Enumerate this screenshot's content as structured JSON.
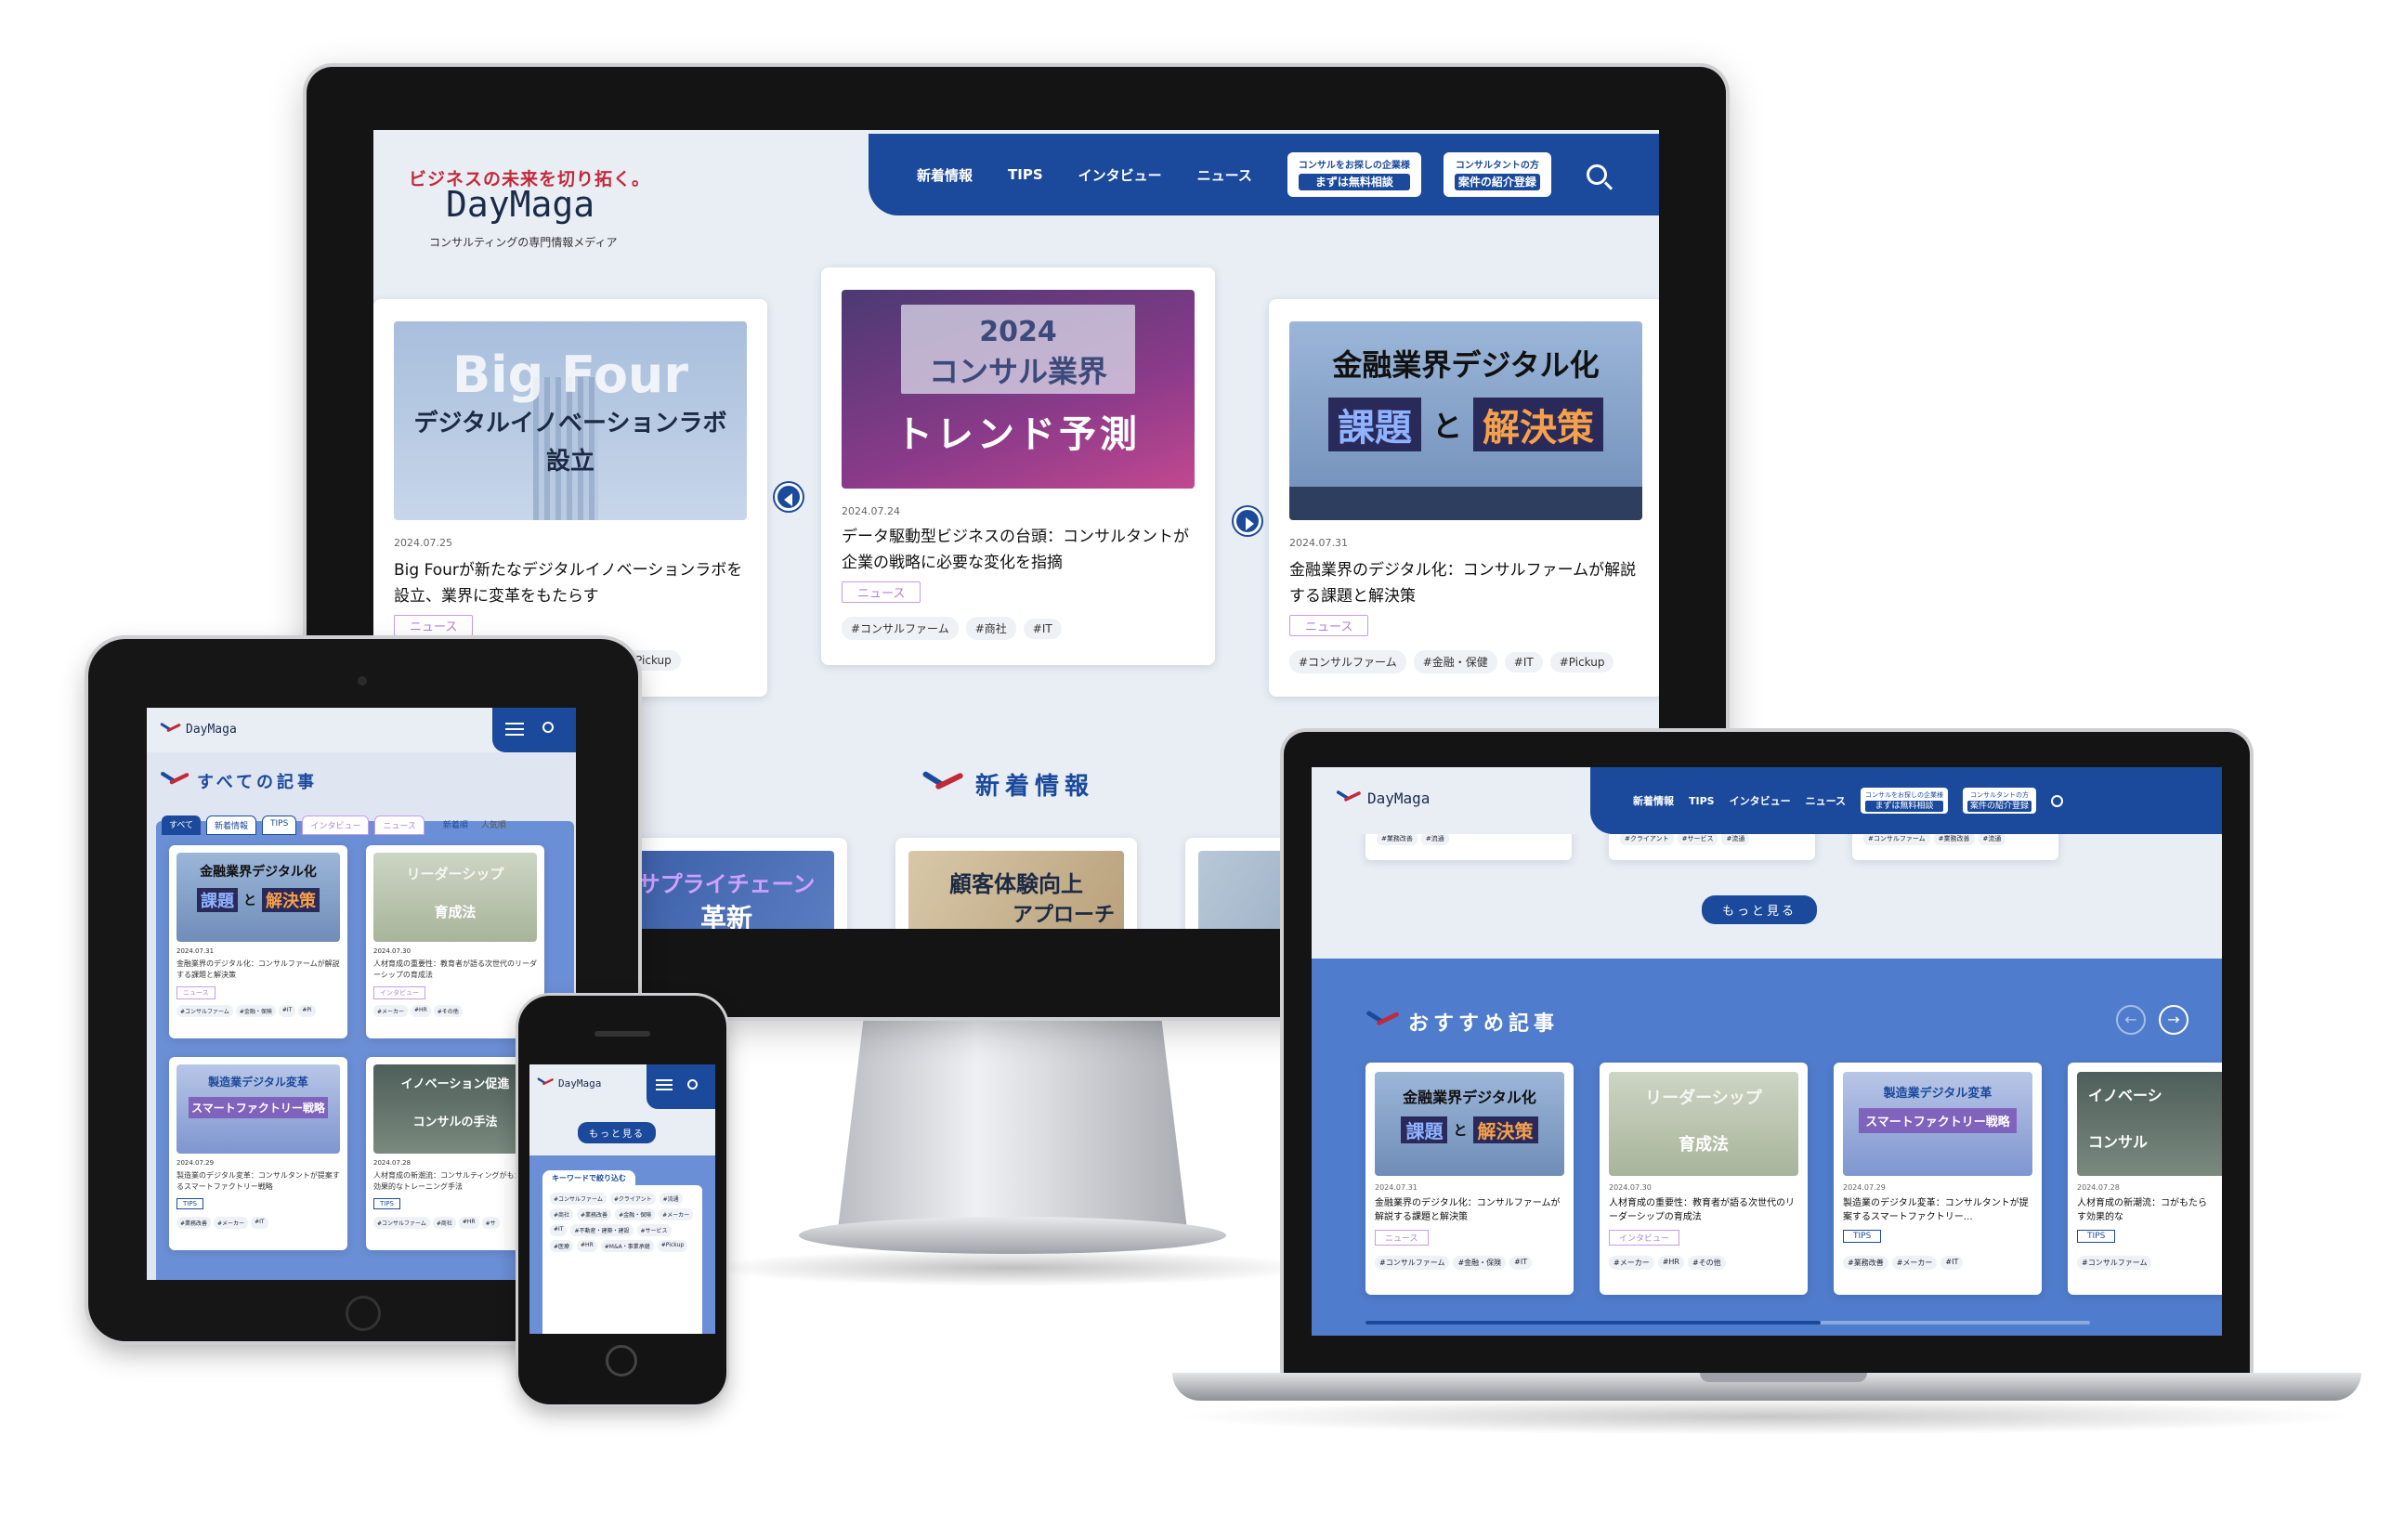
{
  "site": {
    "catchphrase": "ビジネスの未来を切り拓く。",
    "logo": "DayMaga",
    "subtitle": "コンサルティングの専門情報メディア"
  },
  "nav": {
    "items": [
      "新着情報",
      "TIPS",
      "インタビュー",
      "ニュース"
    ],
    "cta_company_small": "コンサルをお探しの企業様",
    "cta_company_big": "まずは無料相談",
    "cta_consultant_small": "コンサルタントの方",
    "cta_consultant_big": "案件の紹介登録",
    "search_icon": "search-icon"
  },
  "featured": [
    {
      "thumb_title": "Big Four",
      "thumb_line1": "デジタルイノベーションラボ",
      "thumb_line2": "設立",
      "date": "2024.07.25",
      "title": "Big Fourが新たなデジタルイノベーションラボを設立、業界に変革をもたらす",
      "category": "ニュース",
      "tags": [
        "#Pickup"
      ]
    },
    {
      "thumb_line1": "2024",
      "thumb_line2": "コンサル業界",
      "thumb_line3": "トレンド予測",
      "date": "2024.07.24",
      "title": "データ駆動型ビジネスの台頭：コンサルタントが企業の戦略に必要な変化を指摘",
      "category": "ニュース",
      "tags": [
        "#コンサルファーム",
        "#商社",
        "#IT"
      ]
    },
    {
      "thumb_line1": "金融業界デジタル化",
      "thumb_word1": "課題",
      "thumb_and": "と",
      "thumb_word2": "解決策",
      "date": "2024.07.31",
      "title": "金融業界のデジタル化：コンサルファームが解説する課題と解決策",
      "category": "ニュース",
      "tags": [
        "#コンサルファーム",
        "#金融・保健",
        "#IT",
        "#Pickup"
      ]
    }
  ],
  "new_section": {
    "title": "新着情報",
    "thumbs": [
      "サプライチェーン",
      "革新",
      "顧客体験向上",
      "アプローチ"
    ]
  },
  "tablet": {
    "section_title": "すべての記事",
    "tabs": [
      "すべて",
      "新着情報",
      "TIPS",
      "インタビュー",
      "ニュース"
    ],
    "sort": [
      "新着順",
      "人気順"
    ],
    "cards": [
      {
        "thumb": "金融業界デジタル化",
        "w1": "課題",
        "and": "と",
        "w2": "解決策",
        "date": "2024.07.31",
        "title": "金融業界のデジタル化：コンサルファームが解説する課題と解決策",
        "badge": "ニュース",
        "tags": [
          "#コンサルファーム",
          "#金融・保険",
          "#IT",
          "#Pi"
        ]
      },
      {
        "thumb": "リーダーシップ",
        "sub": "育成法",
        "date": "2024.07.30",
        "title": "人材育成の重要性：教育者が語る次世代のリーダーシップの育成法",
        "badge": "インタビュー",
        "tags": [
          "#メーカー",
          "#HR",
          "#その他"
        ]
      },
      {
        "thumb": "製造業デジタル変革",
        "sub": "スマートファクトリー戦略",
        "date": "2024.07.29",
        "title": "製造業のデジタル変革：コンサルタントが提案するスマートファクトリー戦略",
        "badge": "TIPS",
        "tags": [
          "#業務改善",
          "#メーカー",
          "#IT"
        ]
      },
      {
        "thumb": "イノベーション促進",
        "sub": "コンサルの手法",
        "date": "2024.07.28",
        "title": "人材育成の新潮流：コンサルティングがもたらす効果的なトレーニング手法",
        "badge": "TIPS",
        "tags": [
          "#コンサルファーム",
          "#商社",
          "#HR",
          "#サ"
        ]
      }
    ]
  },
  "phone": {
    "logo": "DayMaga",
    "more": "もっと見る",
    "search_label": "キーワードで絞り込む",
    "tags": [
      "#コンサルファーム",
      "#クライアント",
      "#流通",
      "#商社",
      "#業務改善",
      "#金融・保険",
      "#メーカー",
      "#IT",
      "#不動産・建築・建設",
      "#サービス",
      "#医療",
      "#HR",
      "#M&A・事業承継",
      "#Pickup"
    ]
  },
  "laptop": {
    "top_tags": [
      [
        "#業務改善",
        "#流通"
      ],
      [
        "#クライアント",
        "#サービス",
        "#流通"
      ],
      [
        "#コンサルファーム",
        "#業務改善",
        "#流通"
      ]
    ],
    "more": "もっと見る",
    "recommend_title": "おすすめ記事",
    "cards": [
      {
        "thumb": "金融業界デジタル化",
        "w1": "課題",
        "and": "と",
        "w2": "解決策",
        "date": "2024.07.31",
        "title": "金融業界のデジタル化：コンサルファームが解説する課題と解決策",
        "badge": "ニュース",
        "tags": [
          "#コンサルファーム",
          "#金融・保険",
          "#IT"
        ]
      },
      {
        "thumb": "リーダーシップ",
        "sub": "育成法",
        "date": "2024.07.30",
        "title": "人材育成の重要性：教育者が語る次世代のリーダーシップの育成法",
        "badge": "インタビュー",
        "tags": [
          "#メーカー",
          "#HR",
          "#その他"
        ]
      },
      {
        "thumb": "製造業デジタル変革",
        "sub": "スマートファクトリー戦略",
        "date": "2024.07.29",
        "title": "製造業のデジタル変革：コンサルタントが提案するスマートファクトリー…",
        "badge": "TIPS",
        "tags": [
          "#業務改善",
          "#メーカー",
          "#IT"
        ]
      },
      {
        "thumb": "イノベーシ",
        "sub": "コンサル",
        "date": "2024.07.28",
        "title": "人材育成の新潮流：コがもたらす効果的な",
        "badge": "TIPS",
        "tags": [
          "#コンサルファーム"
        ]
      }
    ]
  },
  "colors": {
    "brand": "#1b4a9c",
    "accent": "#c22a3a",
    "badge": "#b27ed9"
  }
}
